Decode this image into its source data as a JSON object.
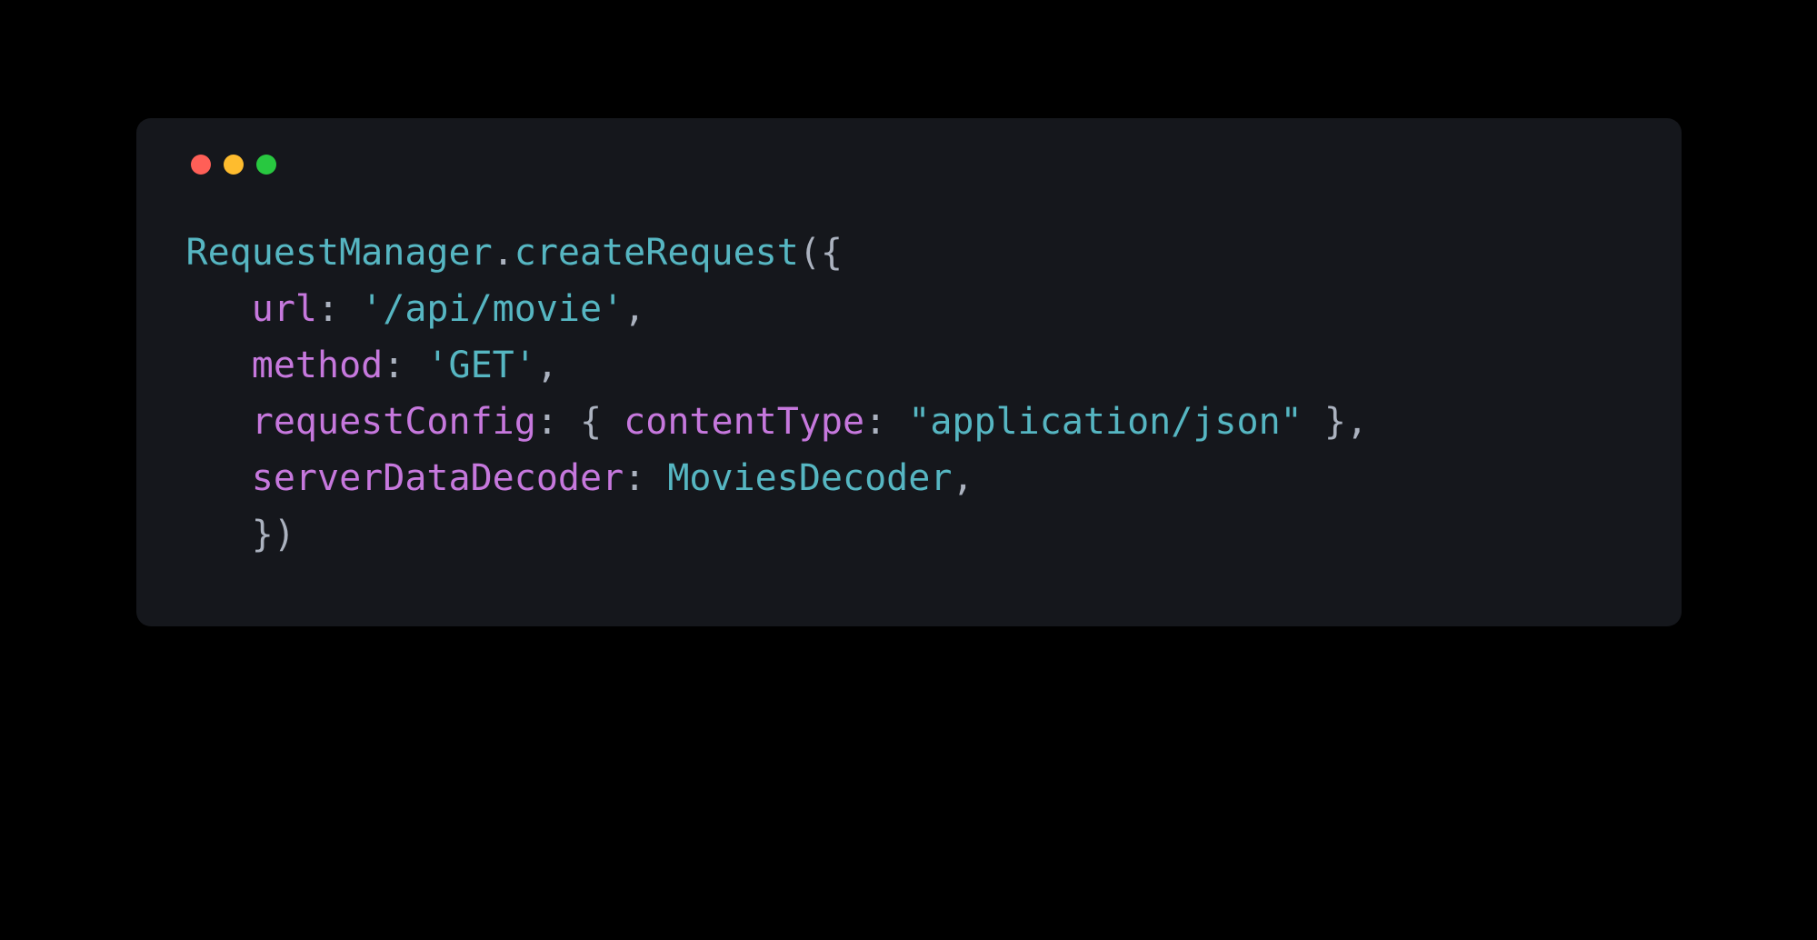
{
  "traffic_lights": {
    "red": "#ff5f57",
    "yellow": "#febc2e",
    "green": "#28c840"
  },
  "code": {
    "line1": {
      "class_name": "RequestManager",
      "dot": ".",
      "method_name": "createRequest",
      "open": "({"
    },
    "line2": {
      "indent": "   ",
      "prop": "url",
      "colon": ": ",
      "value": "'/api/movie'",
      "comma": ","
    },
    "line3": {
      "indent": "   ",
      "prop": "method",
      "colon": ": ",
      "value": "'GET'",
      "comma": ","
    },
    "line4": {
      "indent": "   ",
      "prop": "requestConfig",
      "colon": ": ",
      "open": "{ ",
      "inner_prop": "contentType",
      "inner_colon": ": ",
      "inner_value": "\"application/json\"",
      "close": " },"
    },
    "line5": {
      "indent": "   ",
      "prop": "serverDataDecoder",
      "colon": ": ",
      "value": "MoviesDecoder",
      "comma": ","
    },
    "line6": {
      "indent": "   ",
      "close": "})"
    }
  }
}
